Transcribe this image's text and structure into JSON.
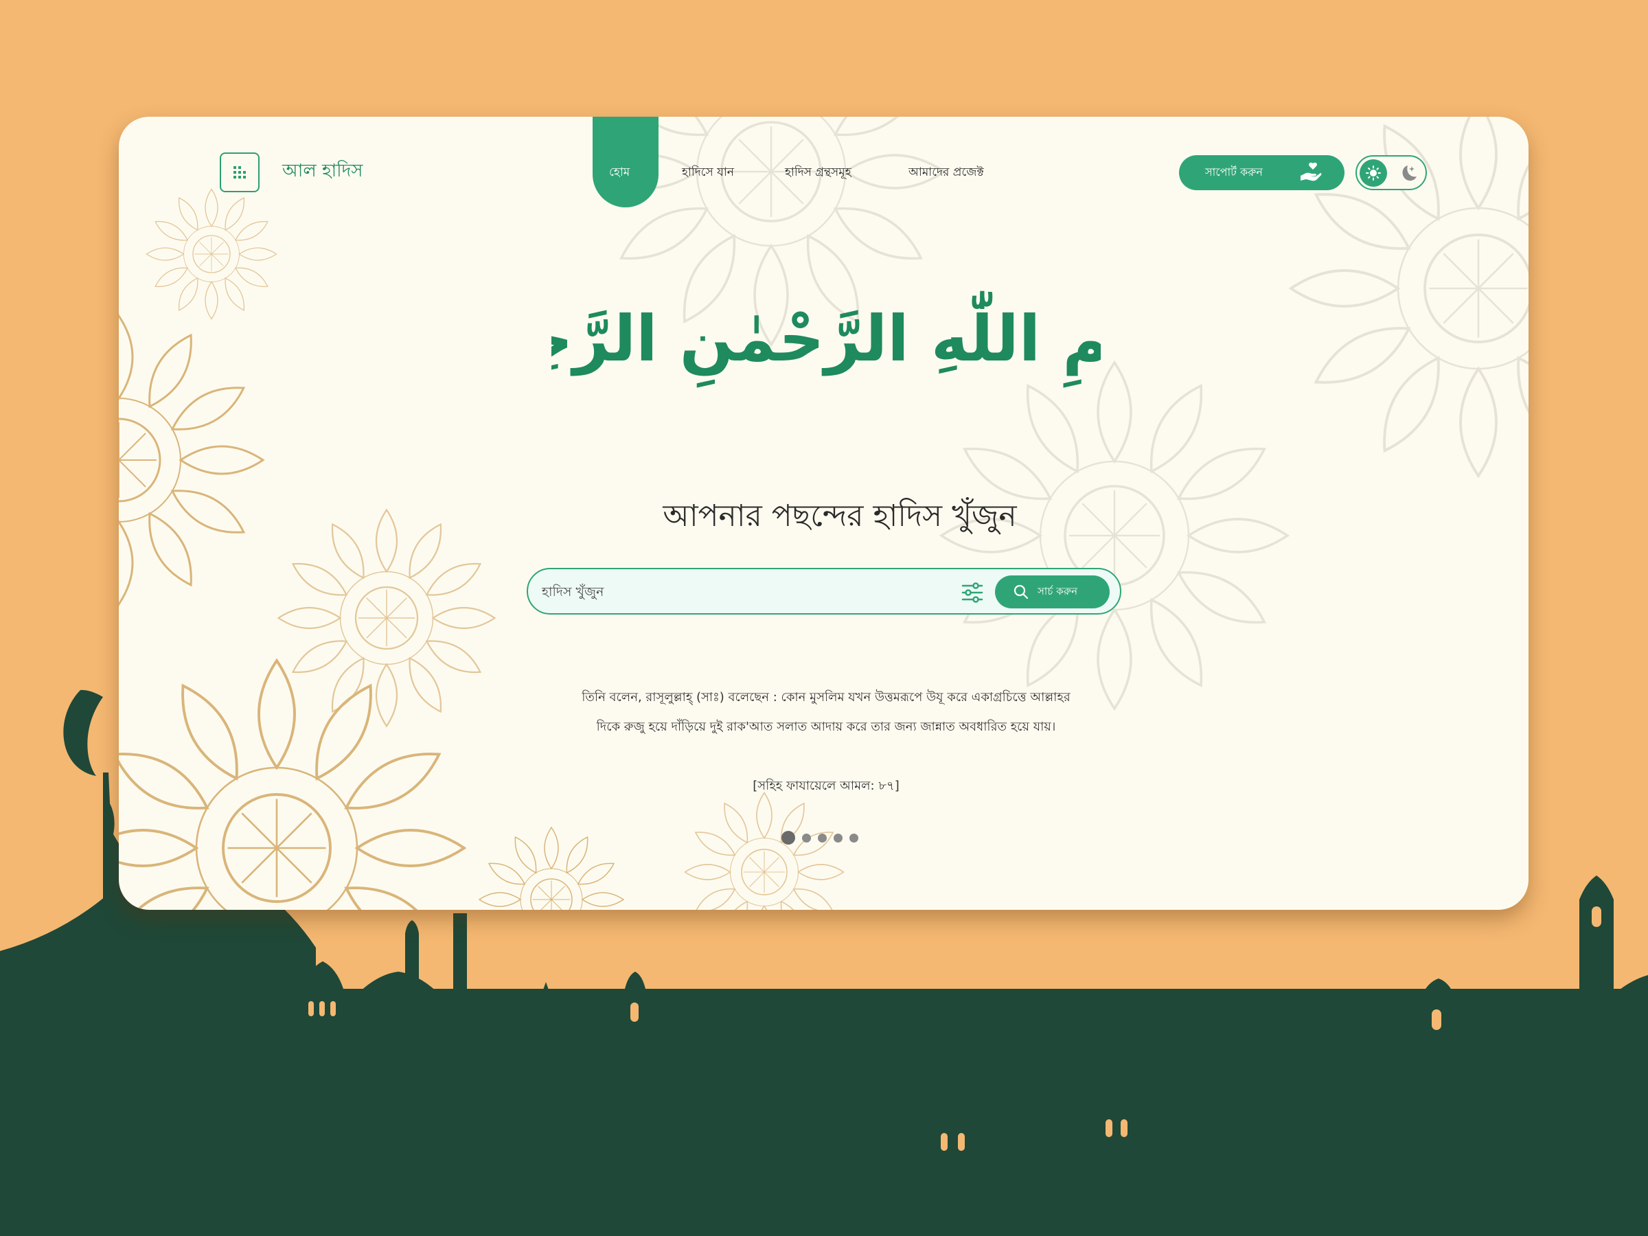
{
  "brand": {
    "name": "আল হাদিস",
    "logo_icon": "hadith-logo-icon"
  },
  "nav": {
    "items": [
      {
        "label": "হোম",
        "active": true
      },
      {
        "label": "হাদিসে যান",
        "active": false
      },
      {
        "label": "হাদিস গ্রন্থসমূহ",
        "active": false
      },
      {
        "label": "আমাদের প্রজেক্ট",
        "active": false
      }
    ]
  },
  "support": {
    "label": "সাপোর্ট করুন",
    "icon": "heart-hand-icon"
  },
  "theme_toggle": {
    "mode": "light",
    "icons": [
      "sun-icon",
      "moon-icon"
    ]
  },
  "calligraphy": {
    "text": "بِسْمِ اللّٰهِ الرَّحْمٰنِ الرَّحِيْمِ"
  },
  "hero": {
    "headline": "আপনার পছন্দের হাদিস খুঁজুন"
  },
  "search": {
    "placeholder": "হাদিস খুঁজুন",
    "button_label": "সার্চ করুন",
    "filter_icon": "filter-sliders-icon",
    "search_icon": "search-icon"
  },
  "hadith": {
    "line1": "তিনি বলেন, রাসূলুল্লাহ্ (সাঃ) বলেছেন : কোন মুসলিম যখন উত্তমরূপে উযূ করে একাগ্রচিত্তে আল্লাহর",
    "line2": "দিকে রুজু হয়ে দাঁড়িয়ে দুই রাক'আত সলাত আদায় করে তার জন্য জান্নাত অবধারিত হয়ে যায়।",
    "reference": "[সহিহ ফাযায়েলে আমল: ৮৭]"
  },
  "carousel": {
    "count": 5,
    "active_index": 0
  },
  "colors": {
    "background": "#f4b872",
    "window": "#fdfbf0",
    "accent": "#2fa577",
    "silhouette": "#1f4838",
    "calligraphy": "#1e8a5e"
  }
}
